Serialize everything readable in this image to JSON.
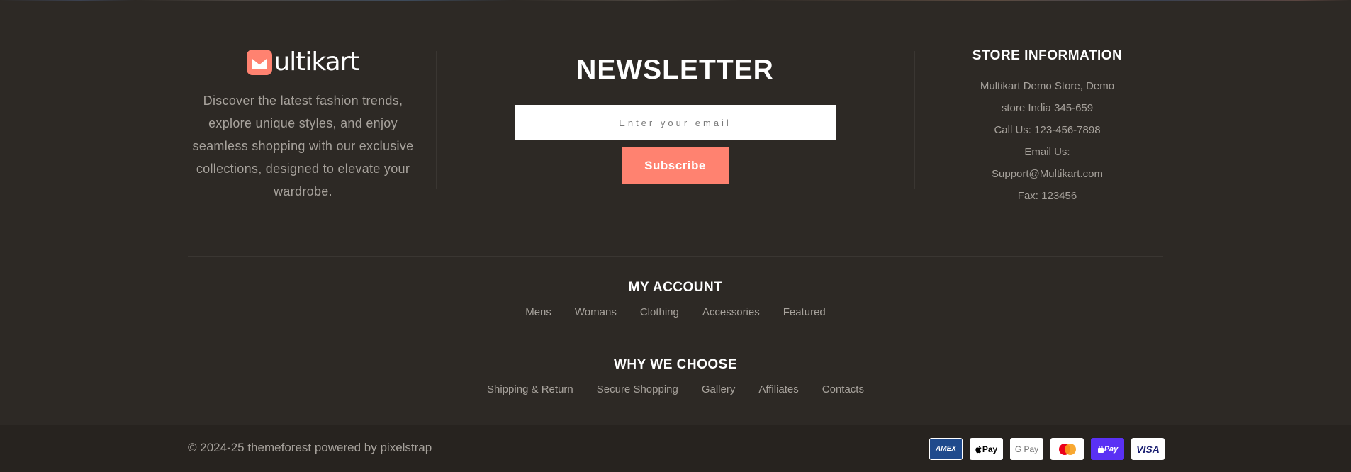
{
  "brand": {
    "logo_text": "ultikart",
    "description": "Discover the latest fashion trends, explore unique styles, and enjoy seamless shopping with our exclusive collections, designed to elevate your wardrobe."
  },
  "newsletter": {
    "title": "NEWSLETTER",
    "email_placeholder": "Enter your email",
    "subscribe_label": "Subscribe"
  },
  "store_info": {
    "title": "STORE INFORMATION",
    "lines": [
      "Multikart Demo Store, Demo",
      "store India 345-659",
      "Call Us: 123-456-7898",
      "Email Us:",
      "Support@Multikart.com",
      "Fax: 123456"
    ]
  },
  "my_account": {
    "title": "MY ACCOUNT",
    "links": [
      "Mens",
      "Womans",
      "Clothing",
      "Accessories",
      "Featured"
    ]
  },
  "why_we_choose": {
    "title": "WHY WE CHOOSE",
    "links": [
      "Shipping & Return",
      "Secure Shopping",
      "Gallery",
      "Affiliates",
      "Contacts"
    ]
  },
  "footer": {
    "copyright": "© 2024-25 themeforest powered by pixelstrap",
    "payment_methods": [
      {
        "icon": "amex-icon",
        "label": "AMEX"
      },
      {
        "icon": "apple-pay-icon",
        "label": " Pay"
      },
      {
        "icon": "google-pay-icon",
        "label": "G Pay"
      },
      {
        "icon": "mastercard-icon",
        "label": ""
      },
      {
        "icon": "shop-pay-icon",
        "label": "Pay"
      },
      {
        "icon": "visa-icon",
        "label": "VISA"
      }
    ]
  },
  "colors": {
    "background": "#2d2925",
    "bottom_bar": "#27231f",
    "accent": "#ff8270",
    "heading": "#ffffff",
    "text": "#a7a29c"
  }
}
